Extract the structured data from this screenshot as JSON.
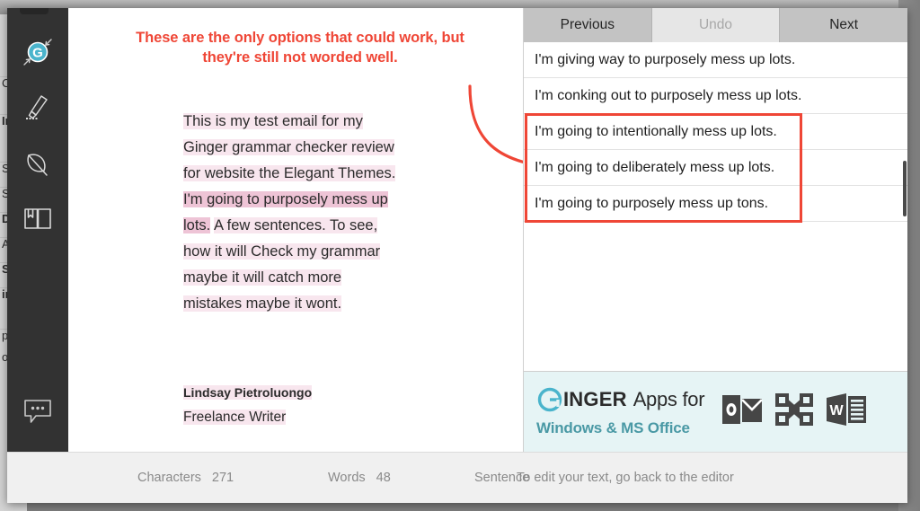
{
  "background": {
    "doc_fragments": [
      "C",
      "In",
      "S",
      "S",
      "D",
      "A",
      "S",
      "in",
      "pa",
      "ot"
    ]
  },
  "sidebar": {
    "items": [
      {
        "name": "ginger-logo",
        "label": "Ginger"
      },
      {
        "name": "highlighter",
        "label": "Proofreader"
      },
      {
        "name": "quill",
        "label": "Rephrase"
      },
      {
        "name": "book",
        "label": "Dictionary"
      },
      {
        "name": "chat",
        "label": "Support"
      }
    ]
  },
  "editor": {
    "callout": "These are the only options that could work, but they're still not worded well.",
    "email_segments": [
      {
        "text": "This is my test email for my Ginger grammar checker review for website the Elegant Themes.",
        "highlight": "light"
      },
      {
        "text": " ",
        "highlight": "none"
      },
      {
        "text": "I'm going to purposely mess up lots.",
        "highlight": "dark"
      },
      {
        "text": " ",
        "highlight": "none"
      },
      {
        "text": "A few sentences. To see, how it will Check my grammar maybe it will catch more mistakes maybe it wont.",
        "highlight": "light"
      }
    ],
    "signature_name": "Lindsay Pietroluongo",
    "signature_title": "Freelance Writer"
  },
  "panel": {
    "buttons": [
      {
        "label": "Previous",
        "disabled": false
      },
      {
        "label": "Undo",
        "disabled": true
      },
      {
        "label": "Next",
        "disabled": false
      }
    ],
    "suggestions": [
      "I'm giving way to purposely mess up lots.",
      "I'm conking out to purposely mess up lots.",
      "I'm going to intentionally mess up lots.",
      "I'm going to deliberately mess up lots.",
      "I'm going to purposely mess up tons."
    ]
  },
  "banner": {
    "brand_initial": "G",
    "brand_rest": "INGER",
    "apps_for": "Apps for",
    "subtitle": "Windows & MS Office",
    "app_icons": [
      "outlook-icon",
      "office-icon",
      "word-icon"
    ]
  },
  "statusbar": {
    "characters_label": "Characters",
    "characters_value": "271",
    "words_label": "Words",
    "words_value": "48",
    "sentence_label": "Sentence",
    "hint": "To edit your text, go back to the editor"
  },
  "colors": {
    "accent_red": "#ef4636",
    "ginger_teal": "#4ab4cc",
    "banner_teal_text": "#4a99a5",
    "banner_bg": "#e6f4f5",
    "highlight_light": "#f8e6ee",
    "highlight_dark": "#eec4d6",
    "sidebar_bg": "#323232"
  }
}
